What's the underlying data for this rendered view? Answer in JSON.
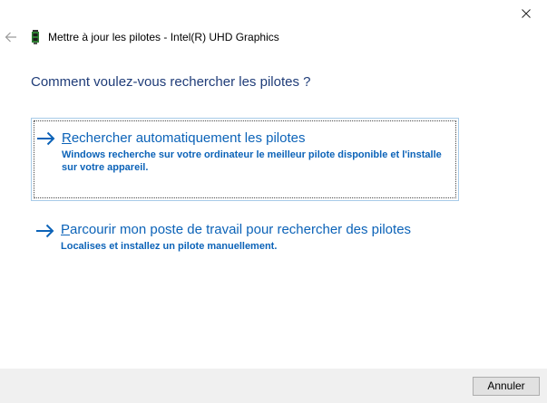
{
  "window": {
    "title": "Mettre à jour les pilotes - Intel(R) UHD Graphics",
    "close_icon": "close-icon",
    "back_icon": "back-arrow-icon",
    "device_icon": "graphics-card-icon"
  },
  "main": {
    "question": "Comment voulez-vous rechercher les pilotes ?",
    "options": [
      {
        "first_letter": "R",
        "title_rest": "echercher automatiquement les pilotes",
        "description": "Windows recherche sur votre ordinateur le meilleur pilote disponible et l'installe sur votre appareil.",
        "icon": "arrow-right-icon"
      },
      {
        "first_letter": "P",
        "title_rest": "arcourir mon poste de travail pour rechercher des pilotes",
        "description": "Localises et installez un pilote manuellement.",
        "icon": "arrow-right-icon"
      }
    ]
  },
  "footer": {
    "cancel_label": "Annuler"
  },
  "colors": {
    "link_blue": "#0c63b8",
    "heading_blue": "#1f3c78",
    "footer_bg": "#f0f0f0",
    "focus_border": "#a8cbe8"
  }
}
